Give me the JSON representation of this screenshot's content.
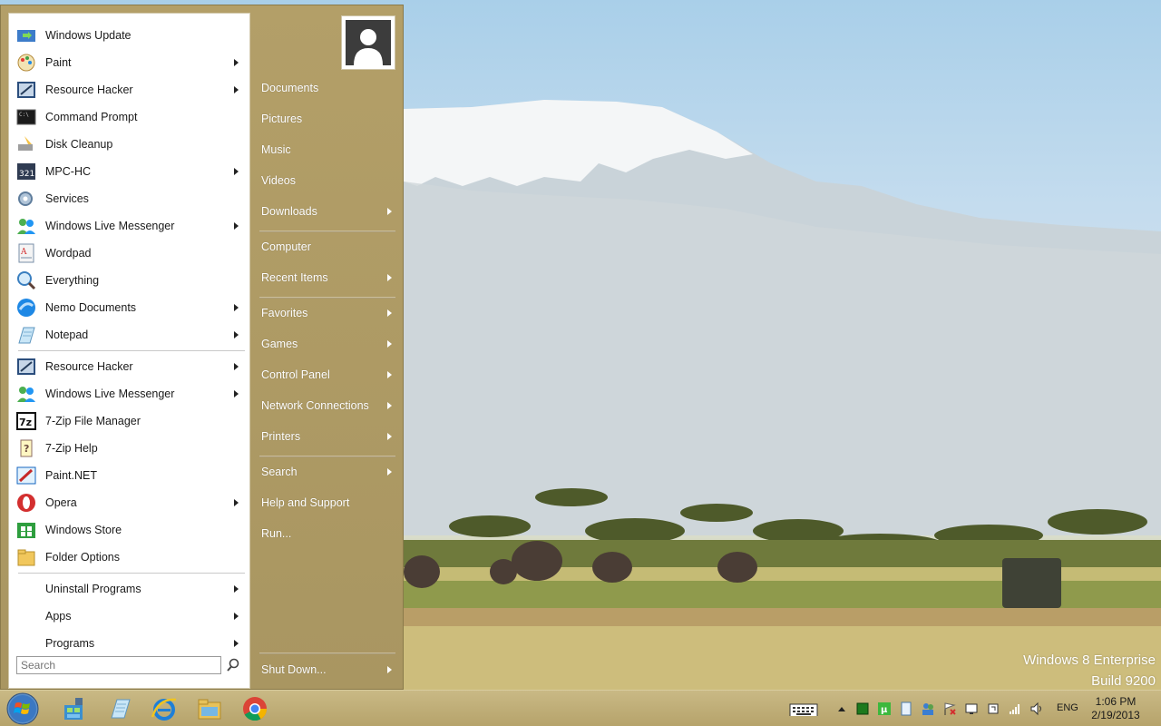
{
  "start_menu": {
    "pinned_items": [
      {
        "label": "Windows Update",
        "icon": "windows-update-icon",
        "has_submenu": false
      },
      {
        "label": "Paint",
        "icon": "paint-icon",
        "has_submenu": true
      },
      {
        "label": "Resource Hacker",
        "icon": "resource-hacker-icon",
        "has_submenu": true
      },
      {
        "label": "Command Prompt",
        "icon": "command-prompt-icon",
        "has_submenu": false
      },
      {
        "label": "Disk Cleanup",
        "icon": "disk-cleanup-icon",
        "has_submenu": false
      },
      {
        "label": "MPC-HC",
        "icon": "mpc-hc-icon",
        "has_submenu": true
      },
      {
        "label": "Services",
        "icon": "services-icon",
        "has_submenu": false
      },
      {
        "label": "Windows Live Messenger",
        "icon": "messenger-icon",
        "has_submenu": true
      },
      {
        "label": "Wordpad",
        "icon": "wordpad-icon",
        "has_submenu": false
      },
      {
        "label": "Everything",
        "icon": "everything-icon",
        "has_submenu": false
      },
      {
        "label": "Nemo Documents",
        "icon": "nemo-documents-icon",
        "has_submenu": true
      },
      {
        "label": "Notepad",
        "icon": "notepad-icon",
        "has_submenu": true
      }
    ],
    "recent_items": [
      {
        "label": "Resource Hacker",
        "icon": "resource-hacker-icon",
        "has_submenu": true
      },
      {
        "label": "Windows Live Messenger",
        "icon": "messenger-icon",
        "has_submenu": true
      },
      {
        "label": "7-Zip File Manager",
        "icon": "7zip-icon",
        "has_submenu": false
      },
      {
        "label": "7-Zip Help",
        "icon": "help-icon",
        "has_submenu": false
      },
      {
        "label": "Paint.NET",
        "icon": "paint-net-icon",
        "has_submenu": false
      },
      {
        "label": "Opera",
        "icon": "opera-icon",
        "has_submenu": true
      },
      {
        "label": "Windows Store",
        "icon": "windows-store-icon",
        "has_submenu": false
      },
      {
        "label": "Folder Options",
        "icon": "folder-options-icon",
        "has_submenu": false
      }
    ],
    "bottom_items": [
      {
        "label": "Uninstall Programs",
        "has_submenu": true
      },
      {
        "label": "Apps",
        "has_submenu": true
      },
      {
        "label": "Programs",
        "has_submenu": true
      }
    ],
    "search_placeholder": "Search",
    "right_groups": [
      [
        {
          "label": "Documents",
          "has_submenu": false
        },
        {
          "label": "Pictures",
          "has_submenu": false
        },
        {
          "label": "Music",
          "has_submenu": false
        },
        {
          "label": "Videos",
          "has_submenu": false
        },
        {
          "label": "Downloads",
          "has_submenu": true
        }
      ],
      [
        {
          "label": "Computer",
          "has_submenu": false
        },
        {
          "label": "Recent Items",
          "has_submenu": true
        }
      ],
      [
        {
          "label": "Favorites",
          "has_submenu": true
        },
        {
          "label": "Games",
          "has_submenu": true
        },
        {
          "label": "Control Panel",
          "has_submenu": true
        },
        {
          "label": "Network Connections",
          "has_submenu": true
        },
        {
          "label": "Printers",
          "has_submenu": true
        }
      ],
      [
        {
          "label": "Search",
          "has_submenu": true
        },
        {
          "label": "Help and Support",
          "has_submenu": false
        },
        {
          "label": "Run...",
          "has_submenu": false
        }
      ]
    ],
    "shutdown_label": "Shut Down..."
  },
  "desktop": {
    "watermark_line1": "Windows 8 Enterprise",
    "watermark_line2": "Build 9200"
  },
  "taskbar": {
    "pinned_apps": [
      "start-orb-icon",
      "network-app-icon",
      "notepad-icon",
      "internet-explorer-icon",
      "file-explorer-icon",
      "chrome-icon"
    ],
    "tray_icons": [
      "keyboard-icon",
      "show-hidden-icons",
      "green-app-icon",
      "utorrent-icon",
      "document-icon",
      "users-icon",
      "flag-icon",
      "display-icon",
      "power-icon",
      "signal-icon",
      "volume-icon"
    ],
    "language": "ENG",
    "time": "1:06 PM",
    "date": "2/19/2013"
  },
  "colors": {
    "menu_gold": "#b39f68",
    "taskbar_gold": "#c0ae77"
  }
}
